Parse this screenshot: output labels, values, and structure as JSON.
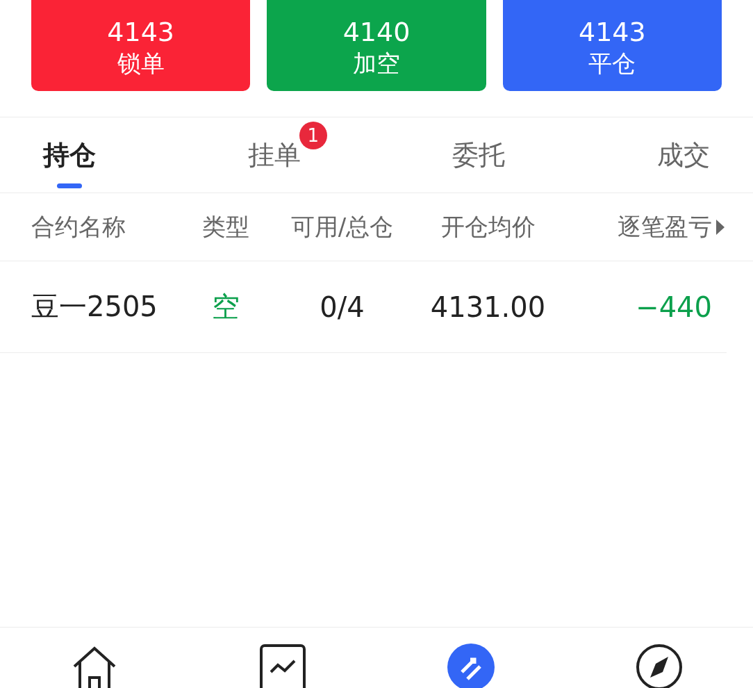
{
  "actions": [
    {
      "price": "4143",
      "label": "锁单",
      "color": "#fa2336"
    },
    {
      "price": "4140",
      "label": "加空",
      "color": "#0ca54c"
    },
    {
      "price": "4143",
      "label": "平仓",
      "color": "#3366f6"
    }
  ],
  "tabs": [
    {
      "label": "持仓",
      "selected": true
    },
    {
      "label": "挂单",
      "selected": false,
      "badge": "1"
    },
    {
      "label": "委托",
      "selected": false
    },
    {
      "label": "成交",
      "selected": false
    }
  ],
  "table": {
    "columns": [
      "合约名称",
      "类型",
      "可用/总仓",
      "开仓均价",
      "逐笔盈亏"
    ],
    "rows": [
      {
        "cells": [
          {
            "text": "豆一2505"
          },
          {
            "text": "空",
            "color": "#0ca04c"
          },
          {
            "text": "0/4"
          },
          {
            "text": "4131.00"
          },
          {
            "text": "−440",
            "color": "#0ca04c"
          }
        ]
      }
    ]
  },
  "nav": [
    {
      "kind": "home",
      "selected": false
    },
    {
      "kind": "chart",
      "selected": false
    },
    {
      "kind": "trade",
      "selected": true
    },
    {
      "kind": "discover",
      "selected": false
    }
  ]
}
